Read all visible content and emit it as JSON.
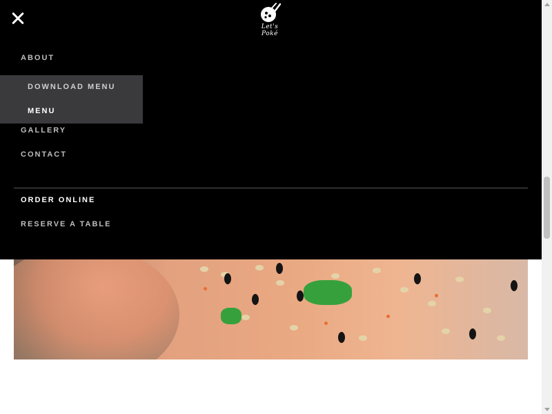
{
  "brand": {
    "logo_text": "Let's Poké"
  },
  "nav": {
    "about": "ABOUT",
    "submenu": {
      "download_menu": "DOWNLOAD MENU",
      "menu": "MENU"
    },
    "gallery": "GALLERY",
    "contact": "CONTACT",
    "order_online": "ORDER ONLINE",
    "reserve_table": "RESERVE A TABLE"
  },
  "icons": {
    "close": "close-icon",
    "logo": "chopsticks-bowl-logo-icon"
  },
  "colors": {
    "overlay_bg": "#000000",
    "submenu_bg": "#3a3a3c",
    "nav_text": "#bdbdbd",
    "active_text": "#ffffff",
    "submenu_text": "#cfcfcf"
  }
}
